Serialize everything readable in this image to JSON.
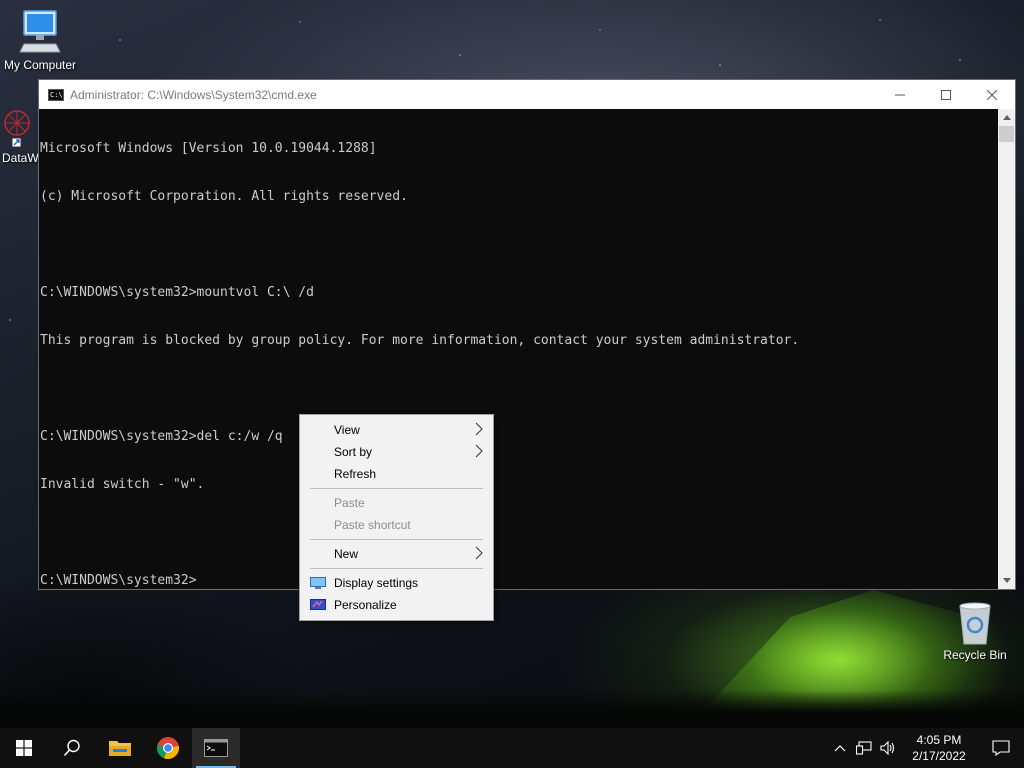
{
  "desktop": {
    "icons": {
      "my_computer": "My Computer",
      "recycle_bin": "Recycle Bin",
      "dataw": "DataW"
    }
  },
  "cmd": {
    "title": "Administrator: C:\\Windows\\System32\\cmd.exe",
    "lines": [
      "Microsoft Windows [Version 10.0.19044.1288]",
      "(c) Microsoft Corporation. All rights reserved.",
      "",
      "C:\\WINDOWS\\system32>mountvol C:\\ /d",
      "This program is blocked by group policy. For more information, contact your system administrator.",
      "",
      "C:\\WINDOWS\\system32>del c:/w /q",
      "Invalid switch - \"w\".",
      "",
      "C:\\WINDOWS\\system32>"
    ]
  },
  "context_menu": {
    "view": "View",
    "sort_by": "Sort by",
    "refresh": "Refresh",
    "paste": "Paste",
    "paste_shortcut": "Paste shortcut",
    "new": "New",
    "display_settings": "Display settings",
    "personalize": "Personalize"
  },
  "taskbar": {
    "time": "4:05 PM",
    "date": "2/17/2022",
    "accent_color": "#76b9ed"
  }
}
